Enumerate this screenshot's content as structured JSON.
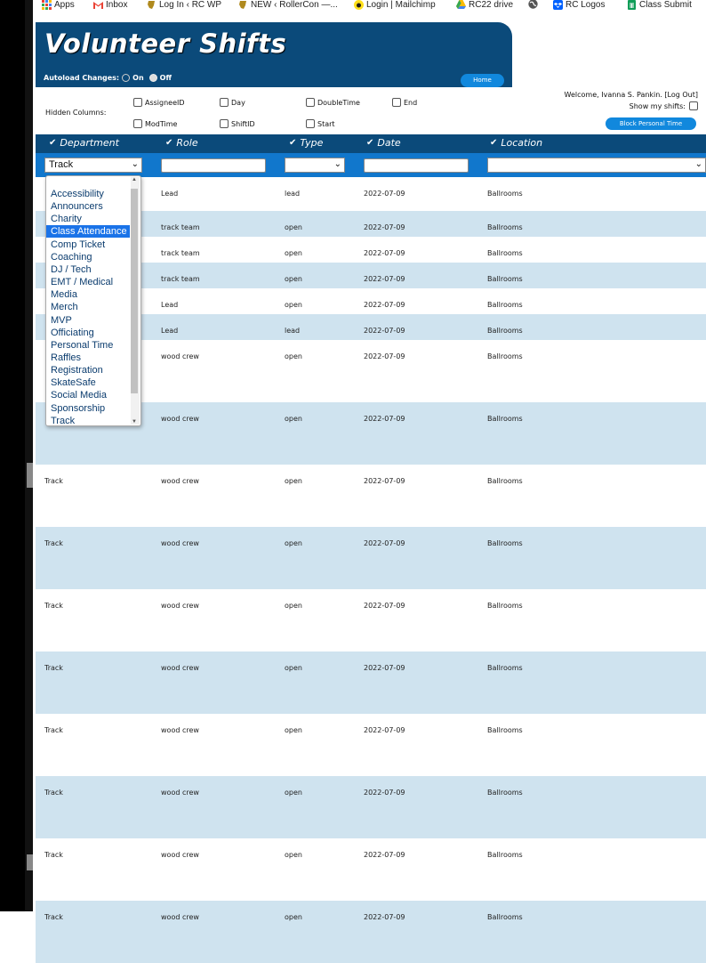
{
  "bookmarks": [
    {
      "label": "Apps",
      "icon": "apps-grid-icon"
    },
    {
      "label": "Inbox",
      "icon": "gmail-icon"
    },
    {
      "label": "Log In ‹ RC WP",
      "icon": "rc-logo-icon"
    },
    {
      "label": "NEW ‹ RollerCon —...",
      "icon": "rc-logo-icon"
    },
    {
      "label": "Login | Mailchimp",
      "icon": "mailchimp-icon"
    },
    {
      "label": "RC22 drive",
      "icon": "google-drive-icon"
    },
    {
      "label": "",
      "icon": "globe-icon"
    },
    {
      "label": "RC Logos",
      "icon": "dropbox-icon"
    },
    {
      "label": "Class Submit",
      "icon": "google-sheets-icon"
    }
  ],
  "header": {
    "title": "Volunteer Shifts",
    "autoload_label": "Autoload Changes:",
    "on_label": "On",
    "off_label": "Off",
    "home_button": "Home"
  },
  "hidden_columns": {
    "label": "Hidden Columns:",
    "options": [
      "AssigneeID",
      "Day",
      "DoubleTime",
      "End",
      "ModTime",
      "ShiftID",
      "Start"
    ]
  },
  "user": {
    "welcome": "Welcome, Ivanna S. Pankin. [Log Out]",
    "show_my_shifts": "Show my shifts:",
    "block_personal_time": "Block Personal Time"
  },
  "columns": [
    "Department",
    "Role",
    "Type",
    "Date",
    "Location"
  ],
  "filters": {
    "department": "Track",
    "role": "",
    "type": "",
    "date": "",
    "location": ""
  },
  "department_options": [
    "Accessibility",
    "Announcers",
    "Charity",
    "Class Attendance",
    "Comp Ticket",
    "Coaching",
    "DJ / Tech",
    "EMT / Medical",
    "Media",
    "Merch",
    "MVP",
    "Officiating",
    "Personal Time",
    "Raffles",
    "Registration",
    "SkateSafe",
    "Social Media",
    "Sponsorship",
    "Track"
  ],
  "highlighted_option": "Class Attendance",
  "rows": [
    {
      "department": "",
      "role": "Lead",
      "type": "lead",
      "date": "2022-07-09",
      "location": "Ballrooms"
    },
    {
      "department": "",
      "role": "track team",
      "type": "open",
      "date": "2022-07-09",
      "location": "Ballrooms"
    },
    {
      "department": "",
      "role": "track team",
      "type": "open",
      "date": "2022-07-09",
      "location": "Ballrooms"
    },
    {
      "department": "",
      "role": "track team",
      "type": "open",
      "date": "2022-07-09",
      "location": "Ballrooms"
    },
    {
      "department": "",
      "role": "Lead",
      "type": "open",
      "date": "2022-07-09",
      "location": "Ballrooms"
    },
    {
      "department": "",
      "role": "Lead",
      "type": "lead",
      "date": "2022-07-09",
      "location": "Ballrooms"
    },
    {
      "department": "",
      "role": "wood crew",
      "type": "open",
      "date": "2022-07-09",
      "location": "Ballrooms"
    },
    {
      "department": "",
      "role": "wood crew",
      "type": "open",
      "date": "2022-07-09",
      "location": "Ballrooms"
    },
    {
      "department": "Track",
      "role": "wood crew",
      "type": "open",
      "date": "2022-07-09",
      "location": "Ballrooms"
    },
    {
      "department": "Track",
      "role": "wood crew",
      "type": "open",
      "date": "2022-07-09",
      "location": "Ballrooms"
    },
    {
      "department": "Track",
      "role": "wood crew",
      "type": "open",
      "date": "2022-07-09",
      "location": "Ballrooms"
    },
    {
      "department": "Track",
      "role": "wood crew",
      "type": "open",
      "date": "2022-07-09",
      "location": "Ballrooms"
    },
    {
      "department": "Track",
      "role": "wood crew",
      "type": "open",
      "date": "2022-07-09",
      "location": "Ballrooms"
    },
    {
      "department": "Track",
      "role": "wood crew",
      "type": "open",
      "date": "2022-07-09",
      "location": "Ballrooms"
    },
    {
      "department": "Track",
      "role": "wood crew",
      "type": "open",
      "date": "2022-07-09",
      "location": "Ballrooms"
    },
    {
      "department": "Track",
      "role": "wood crew",
      "type": "open",
      "date": "2022-07-09",
      "location": "Ballrooms"
    }
  ],
  "colors": {
    "header_blue": "#0b4a7a",
    "filter_blue": "#1177cc",
    "button_blue": "#1188dd",
    "row_alt": "#cfe3ef",
    "highlight": "#1a73e8"
  }
}
